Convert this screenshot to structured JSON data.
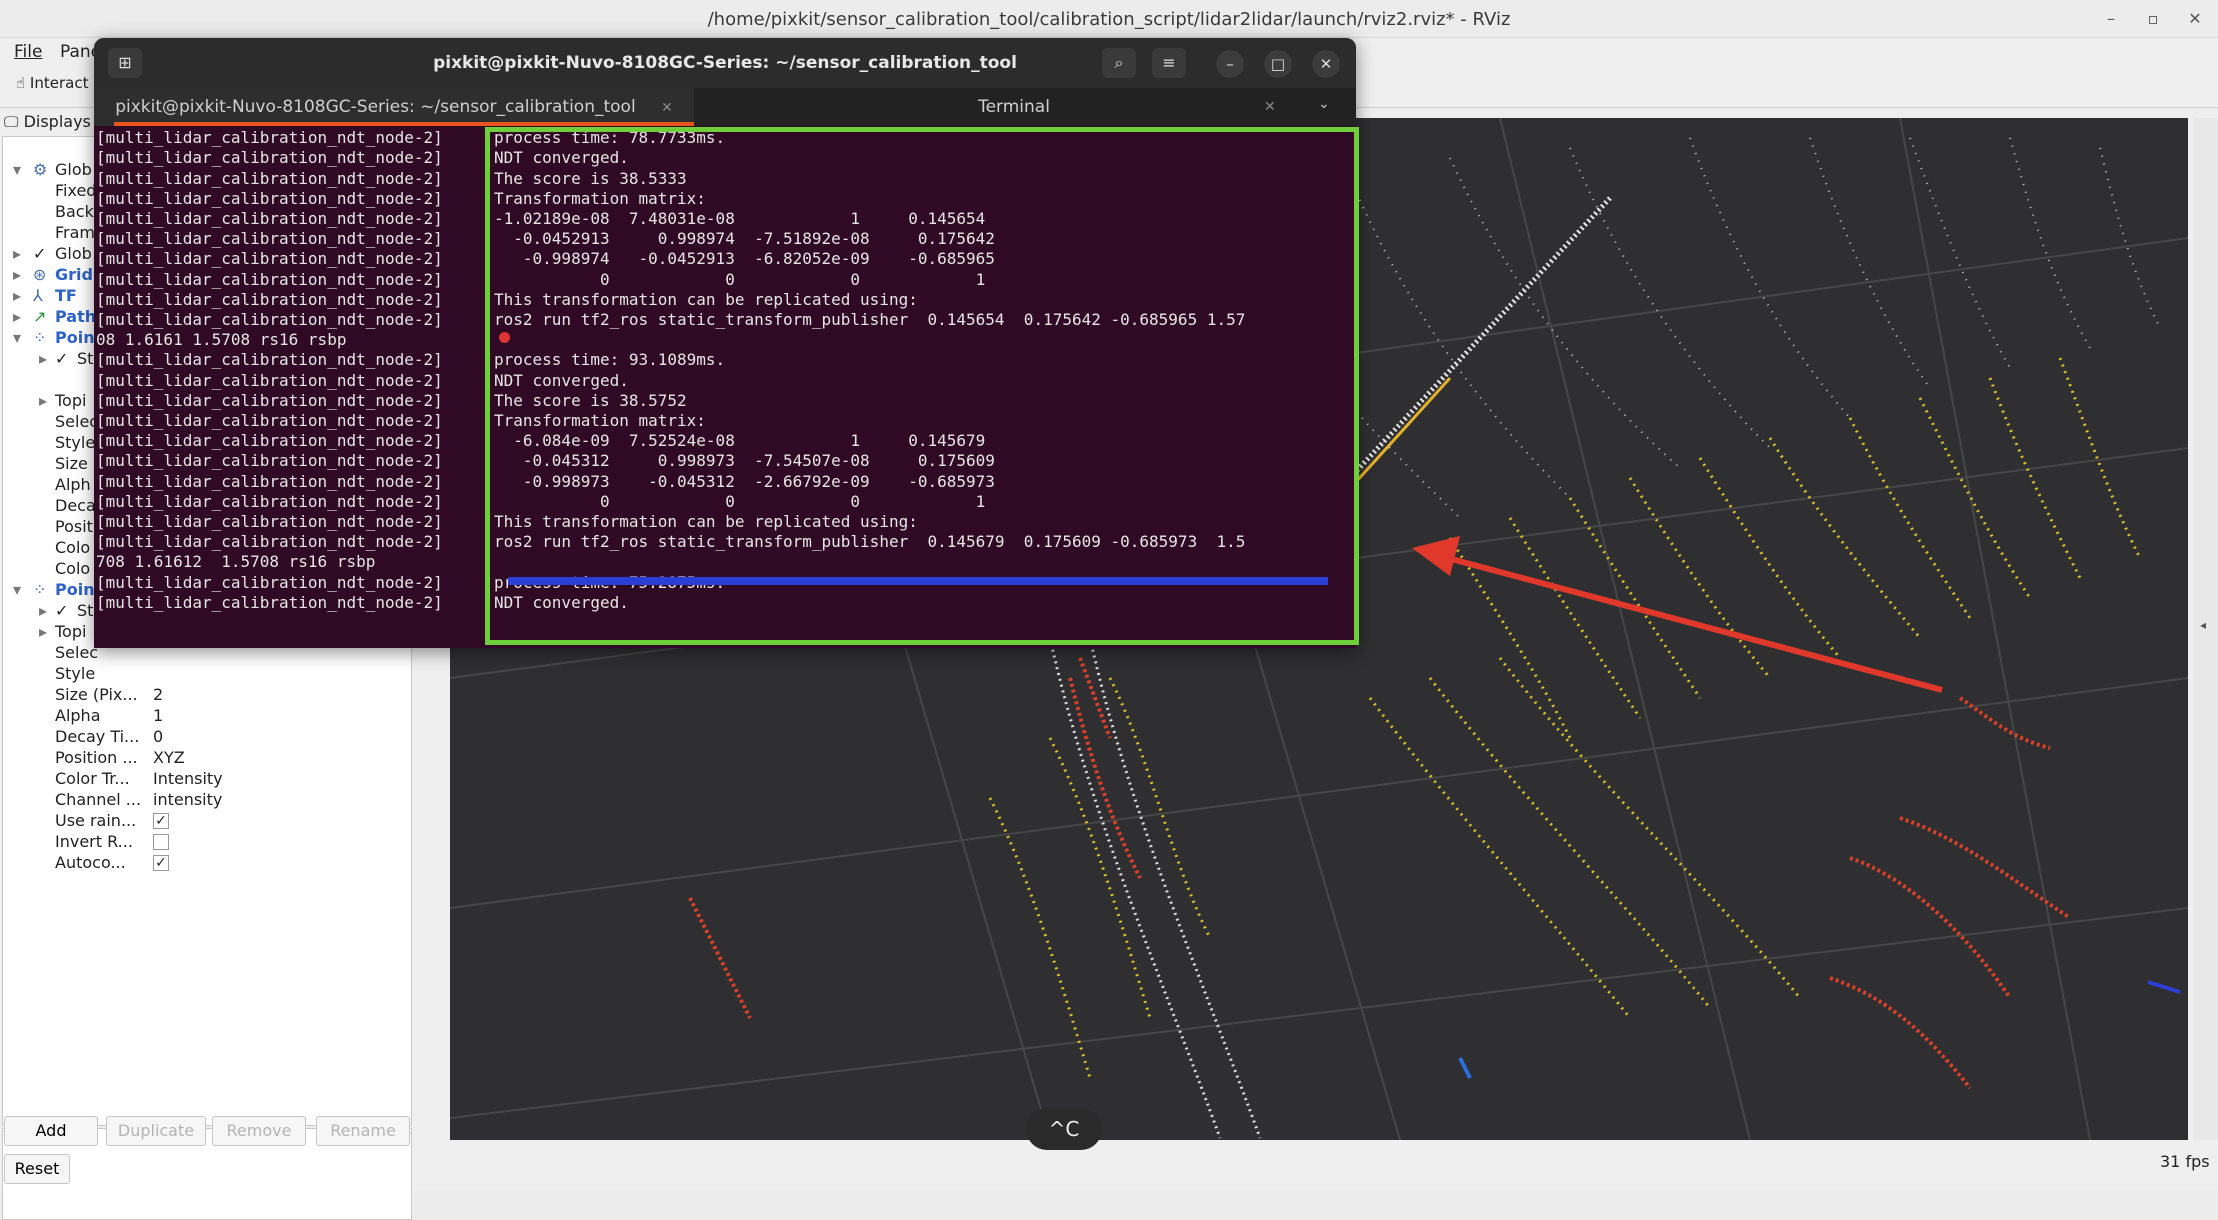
{
  "rviz": {
    "title": "/home/pixkit/sensor_calibration_tool/calibration_script/lidar2lidar/launch/rviz2.rviz* - RViz",
    "menu": {
      "file": "File",
      "panels": "Pane"
    },
    "toolbar": {
      "interact": "Interact"
    },
    "displays_header": "Displays",
    "tree_rows": [
      "Glob",
      "Fixed",
      "Back",
      "Fram",
      "Glob",
      "Grid",
      "TF",
      "Path",
      "Poin",
      "St",
      "Topi",
      "Selec",
      "Style",
      "Size (",
      "Alph",
      "Deca",
      "Posit",
      "Colo",
      "Colo",
      "Poin",
      "St",
      "Topi",
      "Selec",
      "Style"
    ],
    "properties": [
      {
        "key": "Size (Pix...",
        "value": "2"
      },
      {
        "key": "Alpha",
        "value": "1"
      },
      {
        "key": "Decay Ti...",
        "value": "0"
      },
      {
        "key": "Position ...",
        "value": "XYZ"
      },
      {
        "key": "Color Tr...",
        "value": "Intensity"
      },
      {
        "key": "Channel ...",
        "value": "intensity"
      },
      {
        "key": "Use rain...",
        "value": "✓"
      },
      {
        "key": "Invert R...",
        "value": ""
      },
      {
        "key": "Autoco...",
        "value": "✓"
      }
    ],
    "buttons": {
      "add": "Add",
      "duplicate": "Duplicate",
      "remove": "Remove",
      "rename": "Rename",
      "reset": "Reset"
    },
    "fps": "31 fps"
  },
  "terminal": {
    "title": "pixkit@pixkit-Nuvo-8108GC-Series: ~/sensor_calibration_tool",
    "tab1": "pixkit@pixkit-Nuvo-8108GC-Series: ~/sensor_calibration_tool",
    "tab2": "Terminal",
    "left_lines": [
      "[multi_lidar_calibration_ndt_node-2]",
      "[multi_lidar_calibration_ndt_node-2]",
      "[multi_lidar_calibration_ndt_node-2]",
      "[multi_lidar_calibration_ndt_node-2]",
      "[multi_lidar_calibration_ndt_node-2]",
      "[multi_lidar_calibration_ndt_node-2]",
      "[multi_lidar_calibration_ndt_node-2]",
      "[multi_lidar_calibration_ndt_node-2]",
      "[multi_lidar_calibration_ndt_node-2]",
      "[multi_lidar_calibration_ndt_node-2]",
      "08 1.6161 1.5708 rs16 rsbp",
      "[multi_lidar_calibration_ndt_node-2]",
      "[multi_lidar_calibration_ndt_node-2]",
      "[multi_lidar_calibration_ndt_node-2]",
      "[multi_lidar_calibration_ndt_node-2]",
      "[multi_lidar_calibration_ndt_node-2]",
      "[multi_lidar_calibration_ndt_node-2]",
      "[multi_lidar_calibration_ndt_node-2]",
      "[multi_lidar_calibration_ndt_node-2]",
      "[multi_lidar_calibration_ndt_node-2]",
      "[multi_lidar_calibration_ndt_node-2]",
      "708 1.61612  1.5708 rs16 rsbp",
      "[multi_lidar_calibration_ndt_node-2]",
      "[multi_lidar_calibration_ndt_node-2]"
    ],
    "right_lines": [
      "process time: 78.7733ms.",
      "NDT converged.",
      "The score is 38.5333",
      "Transformation matrix:",
      "-1.02189e-08  7.48031e-08            1     0.145654",
      "  -0.0452913     0.998974  -7.51892e-08     0.175642",
      "   -0.998974   -0.0452913  -6.82052e-09    -0.685965",
      "           0            0            0            1",
      "This transformation can be replicated using:",
      "ros2 run tf2_ros static_transform_publisher  0.145654  0.175642 -0.685965 1.57",
      "",
      "process time: 93.1089ms.",
      "NDT converged.",
      "The score is 38.5752",
      "Transformation matrix:",
      "  -6.084e-09  7.52524e-08            1     0.145679",
      "   -0.045312     0.998973  -7.54507e-08     0.175609",
      "   -0.998973    -0.045312  -2.66792e-09    -0.685973",
      "           0            0            0            1",
      "This transformation can be replicated using:",
      "ros2 run tf2_ros static_transform_publisher  0.145679  0.175609 -0.685973  1.5",
      "",
      "process time: 75.2875ms.",
      "NDT converged."
    ]
  },
  "overlay": {
    "ctrl_c": "^C",
    "highlight_color": "#6fcf3b",
    "arrow_color": "#e0392b"
  }
}
